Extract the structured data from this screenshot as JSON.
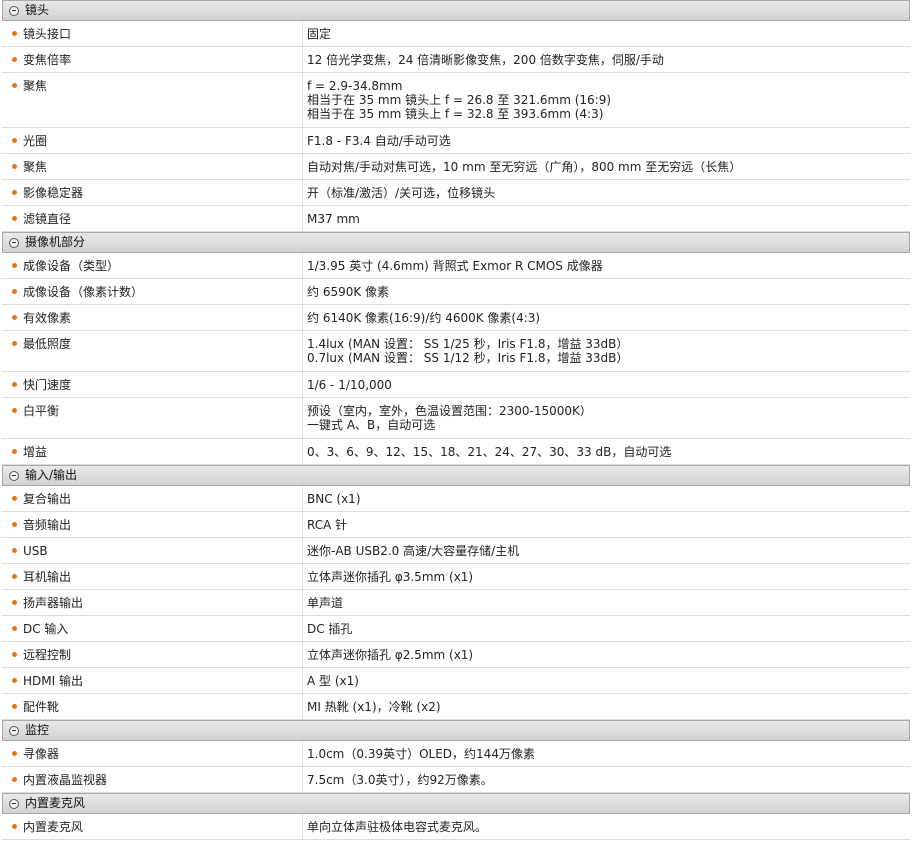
{
  "sections": [
    {
      "title": "镜头",
      "rows": [
        {
          "label": "镜头接口",
          "lines": [
            "固定"
          ]
        },
        {
          "label": "变焦倍率",
          "lines": [
            "12 倍光学变焦，24 倍清晰影像变焦，200 倍数字变焦，伺服/手动"
          ]
        },
        {
          "label": "聚焦",
          "lines": [
            "f = 2.9-34.8mm",
            "相当于在 35 mm 镜头上 f = 26.8 至 321.6mm (16:9)",
            "相当于在 35 mm 镜头上 f = 32.8 至 393.6mm (4:3)"
          ]
        },
        {
          "label": "光圈",
          "lines": [
            "F1.8 - F3.4 自动/手动可选"
          ]
        },
        {
          "label": "聚焦",
          "lines": [
            "自动对焦/手动对焦可选，10 mm 至无穷远（广角），800 mm 至无穷远（长焦）"
          ]
        },
        {
          "label": "影像稳定器",
          "lines": [
            "开（标准/激活）/关可选，位移镜头"
          ]
        },
        {
          "label": "滤镜直径",
          "lines": [
            "M37 mm"
          ]
        }
      ]
    },
    {
      "title": "摄像机部分",
      "rows": [
        {
          "label": "成像设备（类型）",
          "lines": [
            "1/3.95 英寸 (4.6mm) 背照式 Exmor R CMOS 成像器"
          ]
        },
        {
          "label": "成像设备（像素计数）",
          "lines": [
            "约 6590K 像素"
          ]
        },
        {
          "label": "有效像素",
          "lines": [
            "约 6140K 像素(16:9)/约 4600K 像素(4:3)"
          ]
        },
        {
          "label": "最低照度",
          "lines": [
            "1.4lux (MAN 设置： SS 1/25 秒，Iris F1.8，增益 33dB）",
            "0.7lux (MAN 设置： SS 1/12 秒，Iris F1.8，增益 33dB）"
          ]
        },
        {
          "label": "快门速度",
          "lines": [
            "1/6 - 1/10,000"
          ]
        },
        {
          "label": "白平衡",
          "lines": [
            "预设（室内，室外，色温设置范围：2300-15000K）",
            "一键式 A、B，自动可选"
          ]
        },
        {
          "label": "增益",
          "lines": [
            "0、3、6、9、12、15、18、21、24、27、30、33 dB，自动可选"
          ]
        }
      ]
    },
    {
      "title": "输入/输出",
      "rows": [
        {
          "label": "复合输出",
          "lines": [
            "BNC (x1)"
          ]
        },
        {
          "label": "音频输出",
          "lines": [
            "RCA 针"
          ]
        },
        {
          "label": "USB",
          "lines": [
            "迷你-AB USB2.0 高速/大容量存储/主机"
          ]
        },
        {
          "label": "耳机输出",
          "lines": [
            "立体声迷你插孔 φ3.5mm (x1)"
          ]
        },
        {
          "label": "扬声器输出",
          "lines": [
            "单声道"
          ]
        },
        {
          "label": "DC 输入",
          "lines": [
            "DC 插孔"
          ]
        },
        {
          "label": "远程控制",
          "lines": [
            "立体声迷你插孔 φ2.5mm (x1)"
          ]
        },
        {
          "label": "HDMI 输出",
          "lines": [
            "A 型 (x1)"
          ]
        },
        {
          "label": "配件靴",
          "lines": [
            "MI 热靴 (x1)，冷靴 (x2)"
          ]
        }
      ]
    },
    {
      "title": "监控",
      "rows": [
        {
          "label": "寻像器",
          "lines": [
            "1.0cm（0.39英寸）OLED，约144万像素"
          ]
        },
        {
          "label": "内置液晶监视器",
          "lines": [
            "7.5cm（3.0英寸），约92万像素。"
          ]
        }
      ]
    },
    {
      "title": "内置麦克风",
      "rows": [
        {
          "label": "内置麦克风",
          "lines": [
            "单向立体声驻极体电容式麦克风。"
          ]
        }
      ]
    }
  ]
}
